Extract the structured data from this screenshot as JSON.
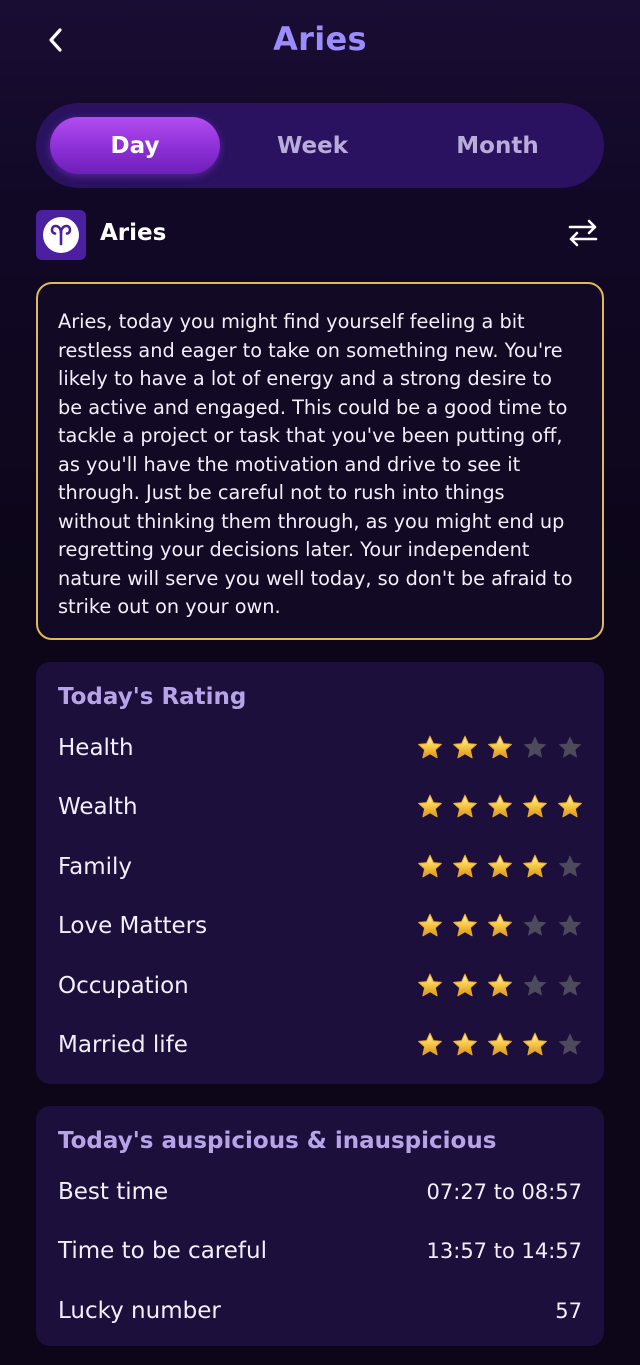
{
  "header": {
    "title": "Aries"
  },
  "tabs": [
    {
      "label": "Day",
      "active": true
    },
    {
      "label": "Week",
      "active": false
    },
    {
      "label": "Month",
      "active": false
    }
  ],
  "sign": {
    "name": "Aries",
    "icon": "aries-symbol-icon"
  },
  "forecast": {
    "text": "Aries, today you might find yourself feeling a bit restless and eager to take on something new. You're likely to have a lot of energy and a strong desire to be active and engaged. This could be a good time to tackle a project or task that you've been putting off, as you'll have the motivation and drive to see it through. Just be careful not to rush into things without thinking them through, as you might end up regretting your decisions later. Your independent nature will serve you well today, so don't be afraid to strike out on your own."
  },
  "rating": {
    "title": "Today's Rating",
    "max_stars": 5,
    "items": [
      {
        "label": "Health",
        "stars": 3
      },
      {
        "label": "Wealth",
        "stars": 5
      },
      {
        "label": "Family",
        "stars": 4
      },
      {
        "label": "Love Matters",
        "stars": 3
      },
      {
        "label": "Occupation",
        "stars": 3
      },
      {
        "label": "Married life",
        "stars": 4
      }
    ]
  },
  "auspicious": {
    "title": "Today's auspicious & inauspicious",
    "items": [
      {
        "label": "Best time",
        "value": "07:27 to 08:57"
      },
      {
        "label": "Time to be careful",
        "value": "13:57 to 14:57"
      },
      {
        "label": "Lucky number",
        "value": "57"
      }
    ]
  },
  "colors": {
    "accent_title": "#9b8cff",
    "tab_active": "#9a3ae0",
    "forecast_border": "#e2b85a",
    "star_filled": "#f6c945",
    "star_empty": "#4d4a5c"
  }
}
